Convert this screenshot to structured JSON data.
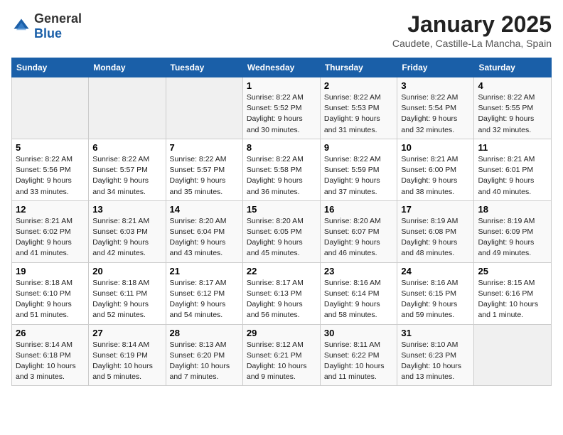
{
  "header": {
    "logo_general": "General",
    "logo_blue": "Blue",
    "title": "January 2025",
    "subtitle": "Caudete, Castille-La Mancha, Spain"
  },
  "weekdays": [
    "Sunday",
    "Monday",
    "Tuesday",
    "Wednesday",
    "Thursday",
    "Friday",
    "Saturday"
  ],
  "weeks": [
    [
      {
        "day": "",
        "info": ""
      },
      {
        "day": "",
        "info": ""
      },
      {
        "day": "",
        "info": ""
      },
      {
        "day": "1",
        "info": "Sunrise: 8:22 AM\nSunset: 5:52 PM\nDaylight: 9 hours\nand 30 minutes."
      },
      {
        "day": "2",
        "info": "Sunrise: 8:22 AM\nSunset: 5:53 PM\nDaylight: 9 hours\nand 31 minutes."
      },
      {
        "day": "3",
        "info": "Sunrise: 8:22 AM\nSunset: 5:54 PM\nDaylight: 9 hours\nand 32 minutes."
      },
      {
        "day": "4",
        "info": "Sunrise: 8:22 AM\nSunset: 5:55 PM\nDaylight: 9 hours\nand 32 minutes."
      }
    ],
    [
      {
        "day": "5",
        "info": "Sunrise: 8:22 AM\nSunset: 5:56 PM\nDaylight: 9 hours\nand 33 minutes."
      },
      {
        "day": "6",
        "info": "Sunrise: 8:22 AM\nSunset: 5:57 PM\nDaylight: 9 hours\nand 34 minutes."
      },
      {
        "day": "7",
        "info": "Sunrise: 8:22 AM\nSunset: 5:57 PM\nDaylight: 9 hours\nand 35 minutes."
      },
      {
        "day": "8",
        "info": "Sunrise: 8:22 AM\nSunset: 5:58 PM\nDaylight: 9 hours\nand 36 minutes."
      },
      {
        "day": "9",
        "info": "Sunrise: 8:22 AM\nSunset: 5:59 PM\nDaylight: 9 hours\nand 37 minutes."
      },
      {
        "day": "10",
        "info": "Sunrise: 8:21 AM\nSunset: 6:00 PM\nDaylight: 9 hours\nand 38 minutes."
      },
      {
        "day": "11",
        "info": "Sunrise: 8:21 AM\nSunset: 6:01 PM\nDaylight: 9 hours\nand 40 minutes."
      }
    ],
    [
      {
        "day": "12",
        "info": "Sunrise: 8:21 AM\nSunset: 6:02 PM\nDaylight: 9 hours\nand 41 minutes."
      },
      {
        "day": "13",
        "info": "Sunrise: 8:21 AM\nSunset: 6:03 PM\nDaylight: 9 hours\nand 42 minutes."
      },
      {
        "day": "14",
        "info": "Sunrise: 8:20 AM\nSunset: 6:04 PM\nDaylight: 9 hours\nand 43 minutes."
      },
      {
        "day": "15",
        "info": "Sunrise: 8:20 AM\nSunset: 6:05 PM\nDaylight: 9 hours\nand 45 minutes."
      },
      {
        "day": "16",
        "info": "Sunrise: 8:20 AM\nSunset: 6:07 PM\nDaylight: 9 hours\nand 46 minutes."
      },
      {
        "day": "17",
        "info": "Sunrise: 8:19 AM\nSunset: 6:08 PM\nDaylight: 9 hours\nand 48 minutes."
      },
      {
        "day": "18",
        "info": "Sunrise: 8:19 AM\nSunset: 6:09 PM\nDaylight: 9 hours\nand 49 minutes."
      }
    ],
    [
      {
        "day": "19",
        "info": "Sunrise: 8:18 AM\nSunset: 6:10 PM\nDaylight: 9 hours\nand 51 minutes."
      },
      {
        "day": "20",
        "info": "Sunrise: 8:18 AM\nSunset: 6:11 PM\nDaylight: 9 hours\nand 52 minutes."
      },
      {
        "day": "21",
        "info": "Sunrise: 8:17 AM\nSunset: 6:12 PM\nDaylight: 9 hours\nand 54 minutes."
      },
      {
        "day": "22",
        "info": "Sunrise: 8:17 AM\nSunset: 6:13 PM\nDaylight: 9 hours\nand 56 minutes."
      },
      {
        "day": "23",
        "info": "Sunrise: 8:16 AM\nSunset: 6:14 PM\nDaylight: 9 hours\nand 58 minutes."
      },
      {
        "day": "24",
        "info": "Sunrise: 8:16 AM\nSunset: 6:15 PM\nDaylight: 9 hours\nand 59 minutes."
      },
      {
        "day": "25",
        "info": "Sunrise: 8:15 AM\nSunset: 6:16 PM\nDaylight: 10 hours\nand 1 minute."
      }
    ],
    [
      {
        "day": "26",
        "info": "Sunrise: 8:14 AM\nSunset: 6:18 PM\nDaylight: 10 hours\nand 3 minutes."
      },
      {
        "day": "27",
        "info": "Sunrise: 8:14 AM\nSunset: 6:19 PM\nDaylight: 10 hours\nand 5 minutes."
      },
      {
        "day": "28",
        "info": "Sunrise: 8:13 AM\nSunset: 6:20 PM\nDaylight: 10 hours\nand 7 minutes."
      },
      {
        "day": "29",
        "info": "Sunrise: 8:12 AM\nSunset: 6:21 PM\nDaylight: 10 hours\nand 9 minutes."
      },
      {
        "day": "30",
        "info": "Sunrise: 8:11 AM\nSunset: 6:22 PM\nDaylight: 10 hours\nand 11 minutes."
      },
      {
        "day": "31",
        "info": "Sunrise: 8:10 AM\nSunset: 6:23 PM\nDaylight: 10 hours\nand 13 minutes."
      },
      {
        "day": "",
        "info": ""
      }
    ]
  ]
}
